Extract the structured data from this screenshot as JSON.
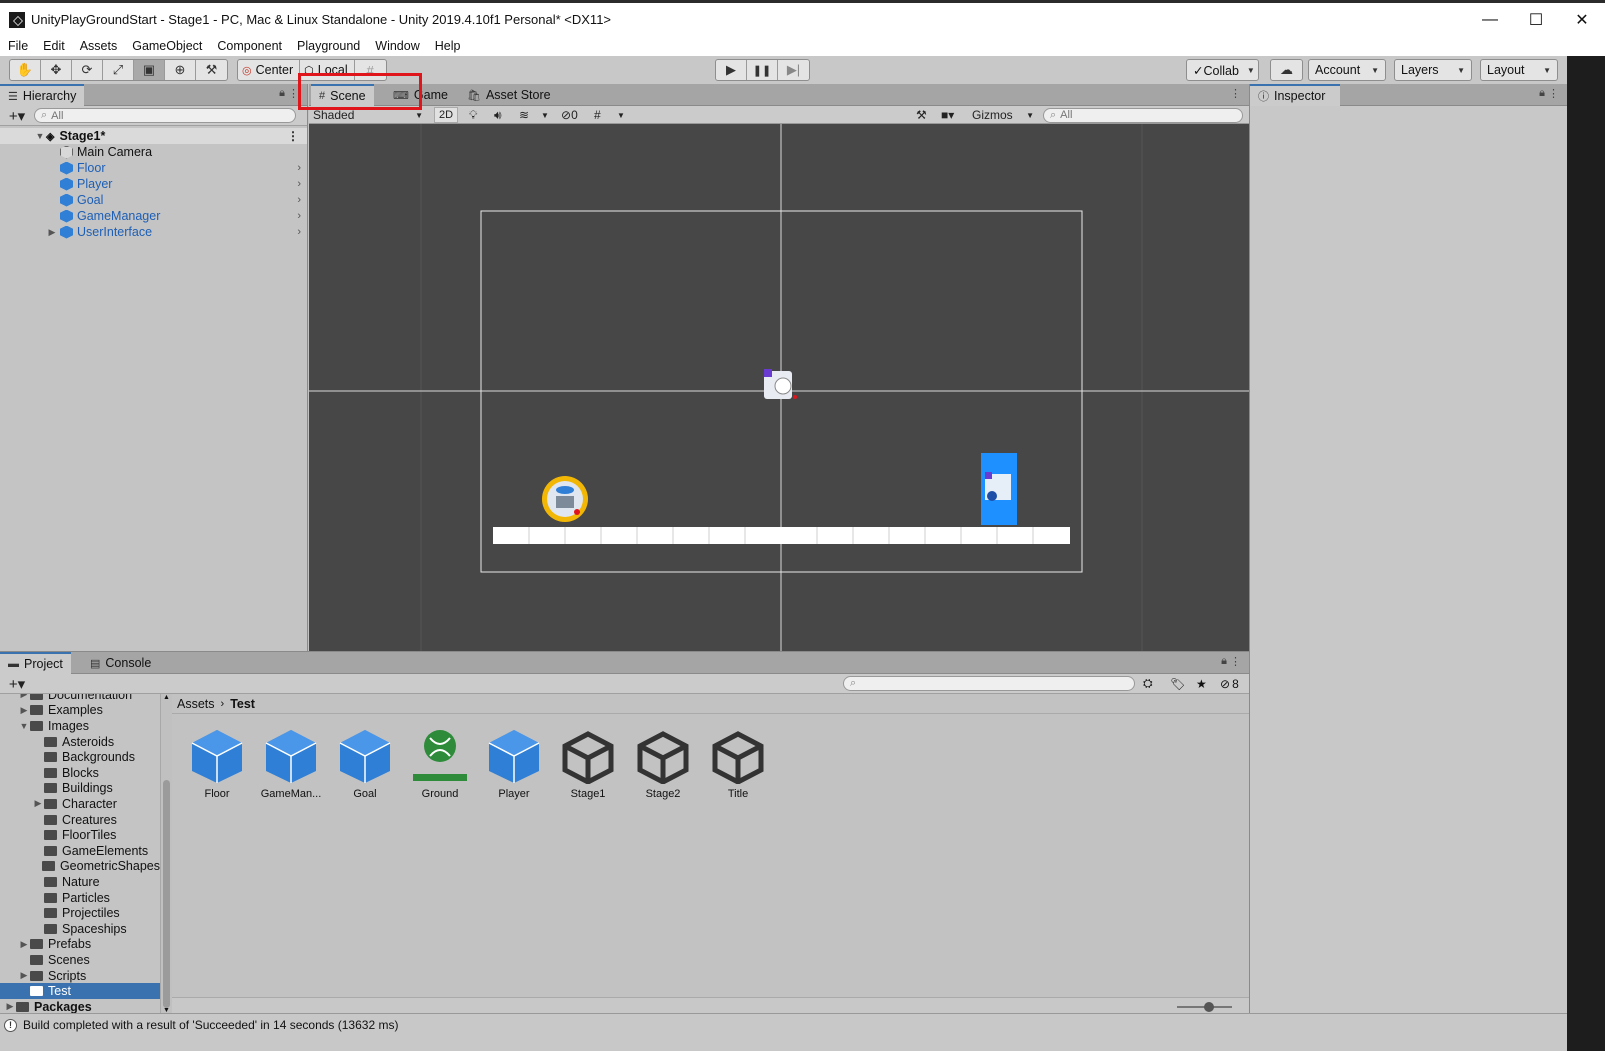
{
  "window": {
    "title": "UnityPlayGroundStart - Stage1 - PC, Mac & Linux Standalone - Unity 2019.4.10f1 Personal* <DX11>",
    "minimize": "—",
    "maximize": "☐",
    "close": "✕"
  },
  "menu": [
    "File",
    "Edit",
    "Assets",
    "GameObject",
    "Component",
    "Playground",
    "Window",
    "Help"
  ],
  "toolbar": {
    "tools": [
      "hand-icon",
      "move-icon",
      "rotate-icon",
      "scale-icon",
      "rect-tool-icon",
      "transform-icon",
      "custom-tool-icon"
    ],
    "pivot_label": "Center",
    "space_label": "Local",
    "collab_label": "Collab",
    "account_label": "Account",
    "layers_label": "Layers",
    "layout_label": "Layout"
  },
  "hierarchy": {
    "tab_label": "Hierarchy",
    "search_placeholder": "All",
    "scene_name": "Stage1*",
    "items": [
      {
        "label": "Main Camera",
        "type": "camera",
        "prefab": false,
        "expandable": false
      },
      {
        "label": "Floor",
        "type": "object",
        "prefab": true,
        "expandable": false
      },
      {
        "label": "Player",
        "type": "object",
        "prefab": true,
        "expandable": false
      },
      {
        "label": "Goal",
        "type": "object",
        "prefab": true,
        "expandable": false
      },
      {
        "label": "GameManager",
        "type": "object",
        "prefab": true,
        "expandable": false
      },
      {
        "label": "UserInterface",
        "type": "object",
        "prefab": true,
        "expandable": true
      }
    ]
  },
  "scene_tabs": {
    "scene": "Scene",
    "game": "Game",
    "asset_store": "Asset Store"
  },
  "scene_toolbar": {
    "shading": "Shaded",
    "mode_2d": "2D",
    "hidden_count": "0",
    "gizmos": "Gizmos",
    "search_placeholder": "All"
  },
  "inspector": {
    "tab_label": "Inspector"
  },
  "project": {
    "tab_label": "Project",
    "console_label": "Console",
    "hidden_count": "8",
    "breadcrumb": [
      "Assets",
      "Test"
    ],
    "folders": [
      {
        "label": "Documentation",
        "indent": 1,
        "expand": "collapsed"
      },
      {
        "label": "Examples",
        "indent": 1,
        "expand": "collapsed"
      },
      {
        "label": "Images",
        "indent": 1,
        "expand": "open"
      },
      {
        "label": "Asteroids",
        "indent": 2,
        "expand": "none"
      },
      {
        "label": "Backgrounds",
        "indent": 2,
        "expand": "none"
      },
      {
        "label": "Blocks",
        "indent": 2,
        "expand": "none"
      },
      {
        "label": "Buildings",
        "indent": 2,
        "expand": "none"
      },
      {
        "label": "Character",
        "indent": 2,
        "expand": "collapsed"
      },
      {
        "label": "Creatures",
        "indent": 2,
        "expand": "none"
      },
      {
        "label": "FloorTiles",
        "indent": 2,
        "expand": "none"
      },
      {
        "label": "GameElements",
        "indent": 2,
        "expand": "none"
      },
      {
        "label": "GeometricShapes",
        "indent": 2,
        "expand": "none"
      },
      {
        "label": "Nature",
        "indent": 2,
        "expand": "none"
      },
      {
        "label": "Particles",
        "indent": 2,
        "expand": "none"
      },
      {
        "label": "Projectiles",
        "indent": 2,
        "expand": "none"
      },
      {
        "label": "Spaceships",
        "indent": 2,
        "expand": "none"
      },
      {
        "label": "Prefabs",
        "indent": 1,
        "expand": "collapsed"
      },
      {
        "label": "Scenes",
        "indent": 1,
        "expand": "none"
      },
      {
        "label": "Scripts",
        "indent": 1,
        "expand": "collapsed"
      },
      {
        "label": "Test",
        "indent": 1,
        "expand": "none",
        "selected": true
      },
      {
        "label": "Packages",
        "indent": 0,
        "expand": "collapsed",
        "bold": true
      }
    ],
    "assets": [
      {
        "label": "Floor",
        "kind": "prefab"
      },
      {
        "label": "GameMan...",
        "kind": "prefab"
      },
      {
        "label": "Goal",
        "kind": "prefab"
      },
      {
        "label": "Ground",
        "kind": "tile"
      },
      {
        "label": "Player",
        "kind": "prefab"
      },
      {
        "label": "Stage1",
        "kind": "scene"
      },
      {
        "label": "Stage2",
        "kind": "scene"
      },
      {
        "label": "Title",
        "kind": "scene"
      }
    ]
  },
  "status": {
    "message": "Build completed with a result of 'Succeeded' in 14 seconds (13632 ms)"
  },
  "colors": {
    "prefab_blue": "#2f7fd6",
    "selection_blue": "#3a72b0",
    "highlight_red": "#e0141b",
    "ground_green": "#2e8b3a",
    "viewport_bg": "#474747"
  }
}
